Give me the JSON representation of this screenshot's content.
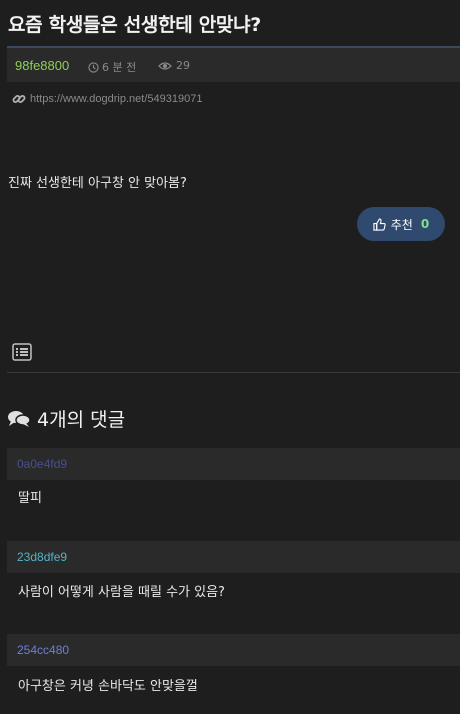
{
  "post": {
    "title": "요즘 학생들은 선생한테 안맞냐?",
    "author": "98fe8800",
    "time": "6 분 전",
    "views": "29",
    "url": "https://www.dogdrip.net/549319071",
    "content": "진짜 선생한테 아구창 안 맞아봄?",
    "like_label": "추천",
    "like_count": "0"
  },
  "comments_section": {
    "title": "4개의 댓글"
  },
  "comments": [
    {
      "author": "0a0e4fd9",
      "text": "딸피",
      "author_color": "#4a4f8c"
    },
    {
      "author": "23d8dfe9",
      "text": "사람이 어떻게 사람을 때릴 수가 있음?",
      "author_color": "#4fb6c8"
    },
    {
      "author": "254cc480",
      "text": "아구창은 커녕 손바닥도 안맞을껄",
      "author_color": "#6f7fd8"
    }
  ],
  "icons": {
    "clock": "clock-icon",
    "eye": "eye-icon",
    "link": "link-icon",
    "thumbs_up": "thumbs-up-icon",
    "list": "list-icon",
    "comments": "comments-icon"
  },
  "colors": {
    "background": "#1e1e1e",
    "author": "#8ccf5a",
    "like_button": "#2f4a6e",
    "like_count": "#7fe08a"
  }
}
